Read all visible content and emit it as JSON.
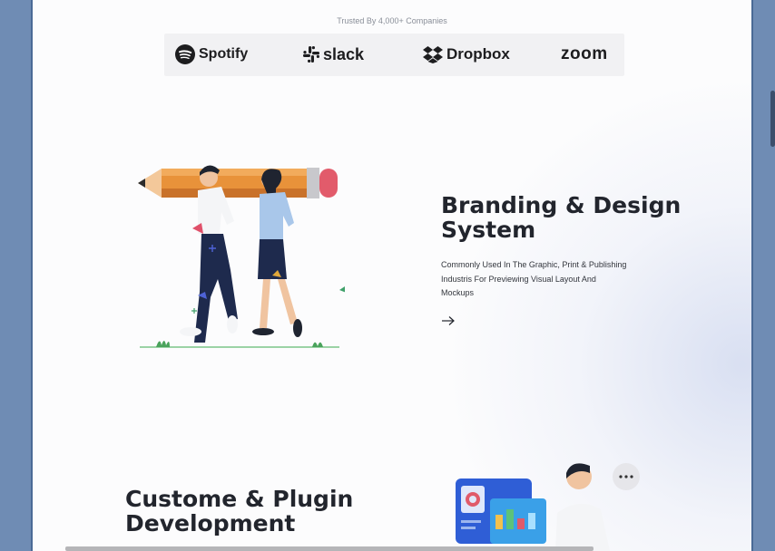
{
  "trusted": {
    "label": "Trusted By 4,000+ Companies"
  },
  "logos": [
    {
      "name": "Spotify",
      "icon": "spotify-icon"
    },
    {
      "name": "slack",
      "icon": "slack-icon"
    },
    {
      "name": "Dropbox",
      "icon": "dropbox-icon"
    },
    {
      "name": "zoom",
      "icon": ""
    }
  ],
  "services": [
    {
      "title_line1": "Branding & Design",
      "title_line2": "System",
      "description_lines": [
        "Commonly Used In The Graphic, Print & Publishing",
        "Industris For Previewing Visual Layout And",
        "Mockups"
      ],
      "link_icon": "arrow-right-icon"
    },
    {
      "title_line1": "Custome & Plugin",
      "title_line2": "Development"
    }
  ],
  "colors": {
    "window_background": "#6f8cb4",
    "page_background": "#fcfcfd",
    "heading": "#22252d",
    "logo_strip": "#f1f1f3"
  }
}
